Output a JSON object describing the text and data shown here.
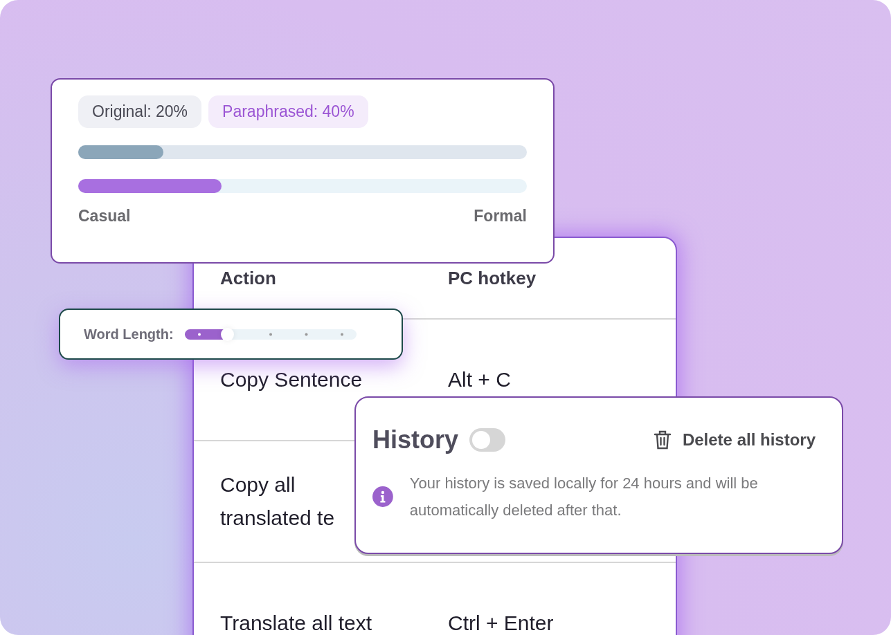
{
  "tone_card": {
    "badges": [
      {
        "label": "Original: 20%",
        "kind": "original"
      },
      {
        "label": "Paraphrased: 40%",
        "kind": "paraphrased"
      }
    ],
    "bars": [
      {
        "kind": "original",
        "level": 0.19
      },
      {
        "kind": "paraphrased",
        "level": 0.32
      }
    ],
    "scale_labels": [
      "Casual",
      "Formal"
    ]
  },
  "hotkey_table": {
    "columns": [
      "Action",
      "PC hotkey"
    ],
    "rows": [
      [
        "Copy Sentence",
        "Alt + C"
      ],
      [
        "Copy all translated te"
      ],
      [
        "Translate all text",
        "Ctrl + Enter"
      ]
    ]
  },
  "word_length": {
    "label": "Word Length:",
    "level": 0.25
  },
  "history": {
    "title": "History",
    "on": false,
    "delete_label": "Delete all history",
    "note": "Your history is saved locally for 24 hours and will be automatically deleted after that."
  }
}
